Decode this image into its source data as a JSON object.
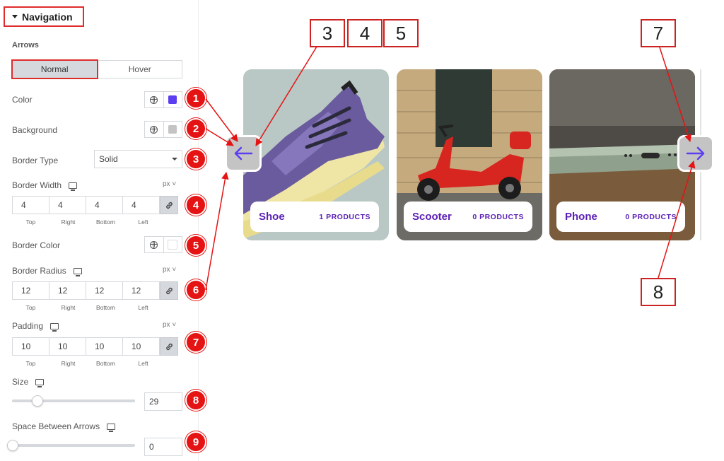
{
  "panel": {
    "section_title": "Navigation",
    "arrows_label": "Arrows",
    "tabs": [
      "Normal",
      "Hover"
    ],
    "color_label": "Color",
    "background_label": "Background",
    "border_type_label": "Border Type",
    "border_type_value": "Solid",
    "border_width_label": "Border Width",
    "border_color_label": "Border Color",
    "border_radius_label": "Border Radius",
    "padding_label": "Padding",
    "size_label": "Size",
    "size_value": "29",
    "space_label": "Space Between Arrows",
    "space_value": "0",
    "unit": "px",
    "side_labels": [
      "Top",
      "Right",
      "Bottom",
      "Left"
    ],
    "border_width_values": [
      "4",
      "4",
      "4",
      "4"
    ],
    "border_radius_values": [
      "12",
      "12",
      "12",
      "12"
    ],
    "padding_values": [
      "10",
      "10",
      "10",
      "10"
    ],
    "color_swatch": "#5b3ef0",
    "background_swatch": "#c4c4c4",
    "border_color_swatch": "#ffffff",
    "size_slider_fraction": 0.2,
    "space_slider_fraction": 0
  },
  "badges": [
    "1",
    "2",
    "3",
    "4",
    "5",
    "6",
    "7",
    "8",
    "9"
  ],
  "callouts": [
    "3",
    "4",
    "5",
    "7",
    "8"
  ],
  "carousel": {
    "cards": [
      {
        "title": "Shoe",
        "count": "1 PRODUCTS"
      },
      {
        "title": "Scooter",
        "count": "0 PRODUCTS"
      },
      {
        "title": "Phone",
        "count": "0 PRODUCTS"
      }
    ],
    "arrow_color": "#5b3ef0"
  },
  "icons": {
    "dropdown": "caret-down-icon",
    "globe": "globe-icon",
    "link": "link-icon",
    "monitor": "monitor-icon",
    "prev": "arrow-left-icon",
    "next": "arrow-right-icon"
  }
}
